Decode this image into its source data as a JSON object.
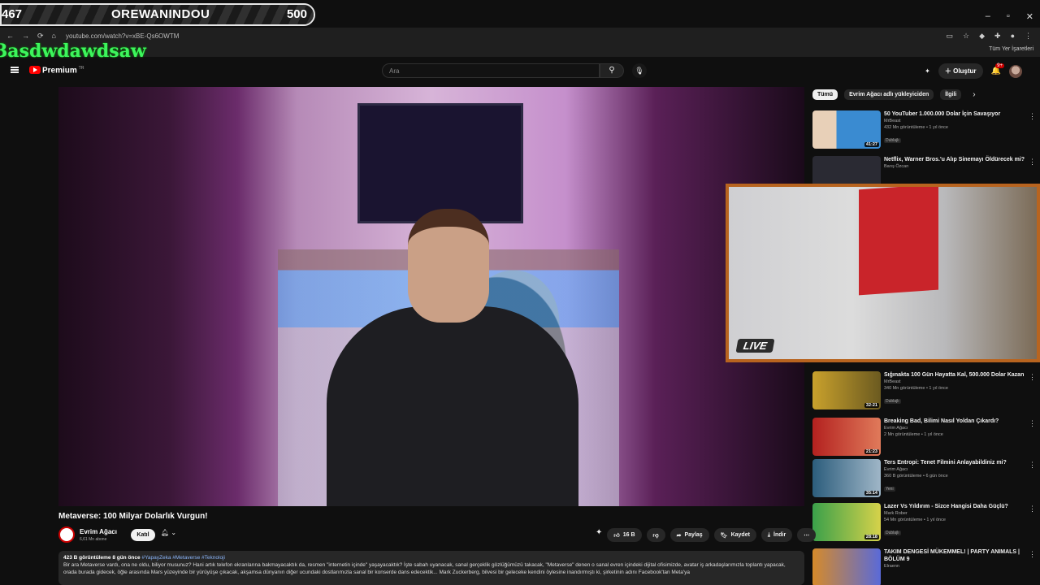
{
  "overlay": {
    "left_value": "467",
    "title": "OREWANINDOU",
    "right_value": "500"
  },
  "window": {
    "minimize": "–",
    "maximize": "▫",
    "close": "✕"
  },
  "browser": {
    "url": "youtube.com/watch?v=xBE-Qs6OWTM",
    "bookmarks_all": "Tüm Yer İşaretleri",
    "nav": {
      "back": "←",
      "forward": "→",
      "reload": "⟳",
      "home": "⌂"
    }
  },
  "stream_name": "3asdwdawdsaw",
  "header": {
    "brand": "Premium",
    "brand_sup": "TR",
    "search_placeholder": "Ara",
    "create_label": "Oluştur",
    "notifications_count": "9+"
  },
  "video": {
    "title": "Metaverse: 100 Milyar Dolarlık Vurgun!",
    "channel": "Evrim Ağacı",
    "subscribers": "6,61 Mn abone",
    "join_label": "Katıl",
    "likes": "16 B",
    "share_label": "Paylaş",
    "save_label": "Kaydet",
    "download_label": "İndir"
  },
  "description": {
    "meta": "423 B görüntüleme  8 gün önce",
    "tags": "#YapayZeka #Metaverse #Teknoloji",
    "text": "Bir ara Metaverse vardı, ona ne oldu, biliyor musunuz? Hani artık telefon ekranlarına bakmayacaktık da, resmen \"internetin içinde\" yaşayacaktık? İşte sabah uyanacak, sanal gerçeklik gözlüğümüzü takacak, \"Metaverse\" denen o sanal evren içindeki dijital ofisimizde, avatar iş arkadaşlarımızla toplantı yapacak, orada burada gidecek, öğle arasında Mars yüzeyinde bir yürüyüşe çıkacak, akşamsa dünyanın diğer ucundaki dostlarımızla sanal bir konserde dans edecektik... Mark Zuckerberg, bilvesi bir geleceke kendini öylesine inandırmıştı ki, şirketinin adını Facebook'tan Meta'ya"
  },
  "chips": [
    "Tümü",
    "Evrim Ağacı adlı yükleyiciden",
    "İlgili"
  ],
  "recommendations": [
    {
      "title": "50 YouTuber 1.000.000 Dolar İçin Savaşıyor",
      "channel": "MrBeast",
      "stats": "432 Mn görüntüleme • 1 yıl önce",
      "duration": "41:27",
      "tag": "Dublajlı",
      "thumb_color": "#3a8bd1"
    },
    {
      "title": "Netflix, Warner Bros.'u Alıp Sinemayı Öldürecek mi?",
      "channel": "Barış Özcan",
      "stats": "",
      "duration": "",
      "tag": "",
      "thumb_color": "#2a2a33"
    },
    {
      "title": "Sığınakta 100 Gün Hayatta Kal, 500.000 Dolar Kazan",
      "channel": "MrBeast",
      "stats": "340 Mn görüntüleme • 1 yıl önce",
      "duration": "32:21",
      "tag": "Dublajlı",
      "thumb_color": "#c9a12c"
    },
    {
      "title": "Breaking Bad, Bilimi Nasıl Yoldan Çıkardı?",
      "channel": "Evrim Ağacı",
      "stats": "2 Mn görüntüleme • 1 yıl önce",
      "duration": "21:23",
      "tag": "",
      "thumb_color": "#b3211f"
    },
    {
      "title": "Ters Entropi: Tenet Filmini Anlayabildiniz mi?",
      "channel": "Evrim Ağacı",
      "stats": "360 B görüntüleme • 6 gün önce",
      "duration": "35:14",
      "tag": "Yeni",
      "thumb_color": "#2c5d7c"
    },
    {
      "title": "Lazer Vs Yıldırım - Sizce Hangisi Daha Güçlü?",
      "channel": "Mark Rober",
      "stats": "54 Mn görüntüleme • 1 yıl önce",
      "duration": "28:18",
      "tag": "Dublajlı",
      "thumb_color": "#3aa04a"
    },
    {
      "title": "TAKIM DENGESİ MÜKEMMEL! | PARTY ANIMALS | BÖLÜM 9",
      "channel": "Elraenn",
      "stats": "",
      "duration": "",
      "tag": "",
      "thumb_color": "#d58a2a"
    }
  ],
  "webcam": {
    "live_label": "LIVE"
  }
}
